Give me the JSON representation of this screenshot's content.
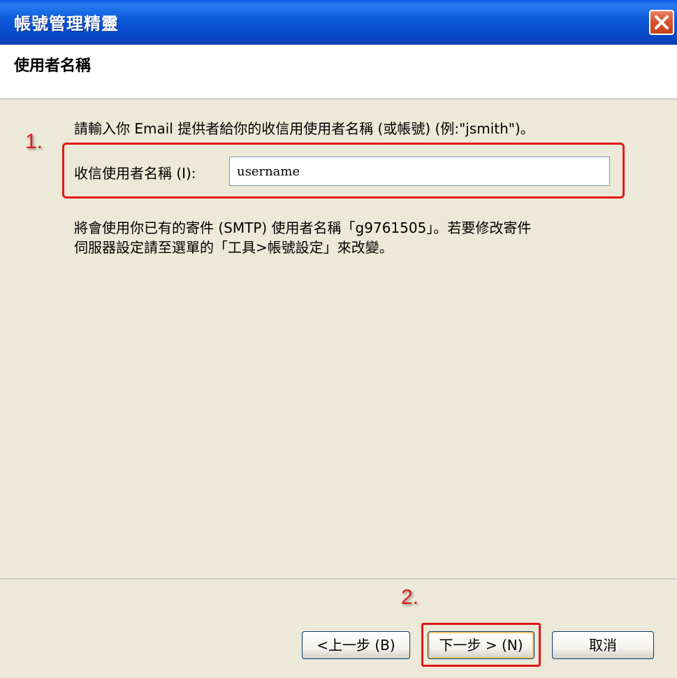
{
  "window": {
    "title": "帳號管理精靈"
  },
  "header": {
    "step_title": "使用者名稱"
  },
  "content": {
    "instruction": "請輸入你 Email 提供者給你的收信用使用者名稱 (或帳號) (例:\"jsmith\")。",
    "field_label": "收信使用者名稱 (I):",
    "username_value": "username",
    "note_line1": "將會使用你已有的寄件 (SMTP) 使用者名稱「g9761505」。若要修改寄件",
    "note_line2": "伺服器設定請至選單的「工具>帳號設定」來改變。"
  },
  "annotations": {
    "step1": "1.",
    "step2": "2.",
    "color": "#e21818"
  },
  "buttons": {
    "back": "<上一步 (B)",
    "next": "下一步 > (N)",
    "cancel": "取消"
  },
  "icons": {
    "close": "close-icon"
  }
}
